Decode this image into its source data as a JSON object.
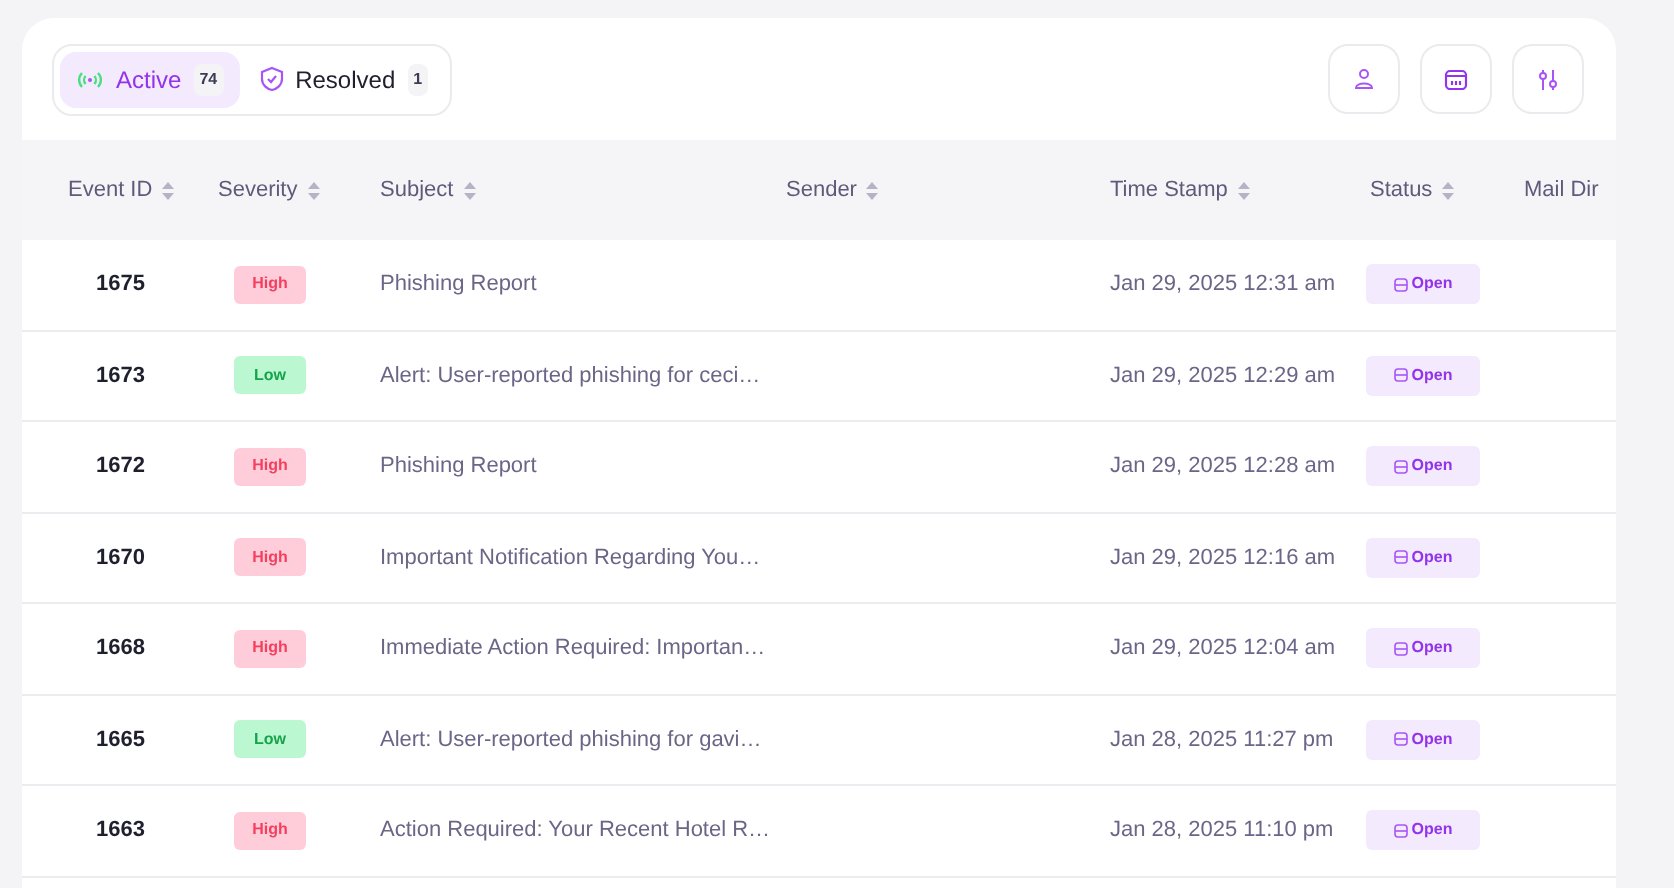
{
  "tabs": [
    {
      "label": "Active",
      "count": "74",
      "selected": true,
      "kind": "active"
    },
    {
      "label": "Resolved",
      "count": "1",
      "selected": false,
      "kind": "resolved"
    }
  ],
  "toolbar": [
    {
      "kind": "user"
    },
    {
      "kind": "calendar"
    },
    {
      "kind": "filter"
    }
  ],
  "table": {
    "columns": [
      {
        "label": "Event ID",
        "sortable": true
      },
      {
        "label": "Severity",
        "sortable": true
      },
      {
        "label": "Subject",
        "sortable": true
      },
      {
        "label": "Sender",
        "sortable": true
      },
      {
        "label": "Time Stamp",
        "sortable": true
      },
      {
        "label": "Status",
        "sortable": true
      },
      {
        "label": "Mail Dir",
        "sortable": false
      }
    ],
    "rows": [
      {
        "event_id": "1675",
        "severity": "High",
        "subject": "Phishing Report",
        "time_stamp": "Jan 29, 2025 12:31 am",
        "status": "Open"
      },
      {
        "event_id": "1673",
        "severity": "Low",
        "subject": "Alert: User-reported phishing for ceci…",
        "time_stamp": "Jan 29, 2025 12:29 am",
        "status": "Open"
      },
      {
        "event_id": "1672",
        "severity": "High",
        "subject": "Phishing Report",
        "time_stamp": "Jan 29, 2025 12:28 am",
        "status": "Open"
      },
      {
        "event_id": "1670",
        "severity": "High",
        "subject": "Important Notification Regarding You…",
        "time_stamp": "Jan 29, 2025 12:16 am",
        "status": "Open"
      },
      {
        "event_id": "1668",
        "severity": "High",
        "subject": "Immediate Action Required: Importan…",
        "time_stamp": "Jan 29, 2025 12:04 am",
        "status": "Open"
      },
      {
        "event_id": "1665",
        "severity": "Low",
        "subject": "Alert: User-reported phishing for gavi…",
        "time_stamp": "Jan 28, 2025 11:27 pm",
        "status": "Open"
      },
      {
        "event_id": "1663",
        "severity": "High",
        "subject": "Action Required: Your Recent Hotel R…",
        "time_stamp": "Jan 28, 2025 11:10 pm",
        "status": "Open"
      }
    ]
  }
}
